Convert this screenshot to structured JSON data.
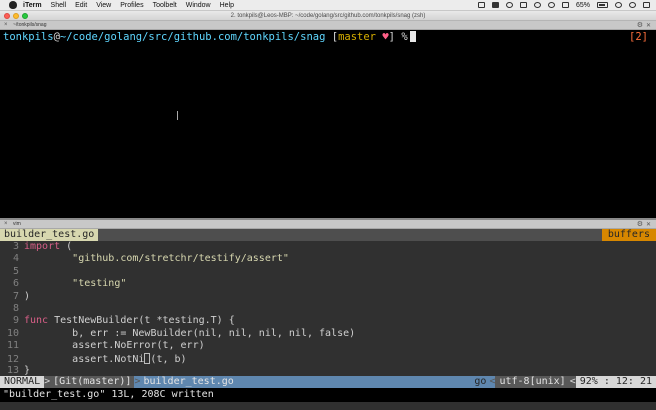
{
  "menubar": {
    "app": "iTerm",
    "items": [
      "Shell",
      "Edit",
      "View",
      "Profiles",
      "Toolbelt",
      "Window",
      "Help"
    ],
    "battery": "65%"
  },
  "window": {
    "title": "2. tonkpils@Leos-MBP: ~/code/golang/src/github.com/tonkpils/snag (zsh)"
  },
  "top_pane": {
    "label": "~/tonkpils/snag",
    "prompt_user": "tonkpils",
    "prompt_at": "@",
    "prompt_path": "~/code/golang/src/github.com/tonkpils/snag",
    "prompt_branch_open": " [",
    "prompt_branch": "master",
    "prompt_heart": " ♥",
    "prompt_branch_close": "]",
    "prompt_symbol": " %",
    "job_count": "[2]"
  },
  "bottom_pane": {
    "label": "vim"
  },
  "vim": {
    "tab_active": "builder_test.go",
    "tab_buffers": "buffers",
    "lines": [
      {
        "n": "3",
        "kw": "import",
        "rest": " ("
      },
      {
        "n": "4",
        "str": "\"github.com/stretchr/testify/assert\""
      },
      {
        "n": "5"
      },
      {
        "n": "6",
        "str": "\"testing\""
      },
      {
        "n": "7",
        "rest": ")"
      },
      {
        "n": "8"
      },
      {
        "n": "9",
        "kw": "func",
        "rest": " TestNewBuilder(t *testing.T) {"
      },
      {
        "n": "10",
        "code": "b, err := NewBuilder(nil, nil, nil, nil, false)"
      },
      {
        "n": "11",
        "code": "assert.NoError(t, err)"
      },
      {
        "n": "12",
        "code_a": "assert.NotNi",
        "code_b": "(t, b)"
      },
      {
        "n": "13",
        "rest": "}"
      }
    ],
    "status": {
      "mode": "NORMAL",
      "branch": "[Git(master)]",
      "file": "builder_test.go",
      "filetype": "go",
      "encoding": "utf-8[unix]",
      "percent": "92%",
      "line": "12",
      "col": "21"
    },
    "message": "\"builder_test.go\" 13L, 208C written"
  }
}
